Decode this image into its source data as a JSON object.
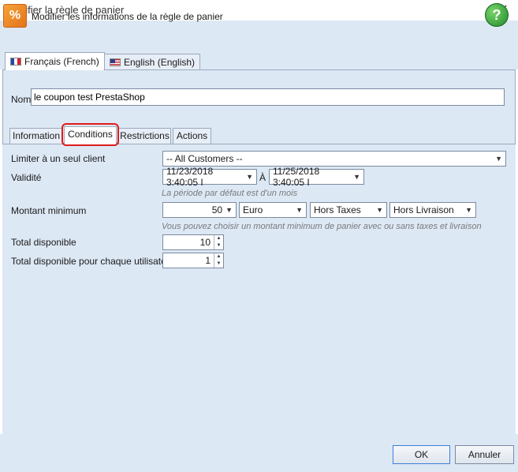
{
  "window": {
    "title": "Modifier la règle de panier",
    "close_glyph": "✕"
  },
  "header": {
    "text": "Modifier les informations de la règle de panier",
    "icon": "percent-tag-icon",
    "icon_glyph": "%",
    "help_glyph": "?"
  },
  "languages": [
    {
      "label": "Français (French)",
      "flag": "flag-fr-icon",
      "active": true
    },
    {
      "label": "English (English)",
      "flag": "flag-us-icon",
      "active": false
    }
  ],
  "name": {
    "label": "Nom",
    "value": "le coupon test PrestaShop"
  },
  "tabs": [
    {
      "label": "Information"
    },
    {
      "label": "Conditions",
      "active": true
    },
    {
      "label": "Restrictions"
    },
    {
      "label": "Actions"
    }
  ],
  "conditions": {
    "customer_label": "Limiter à un seul client",
    "customer_value": "-- All Customers --",
    "validity_label": "Validité",
    "validity_from": "11/23/2018  3:40:05 I",
    "validity_sep": "À",
    "validity_to": "11/25/2018  3:40:05 I",
    "validity_hint": "La période par défaut est d'un mois",
    "min_amount_label": "Montant minimum",
    "min_amount_value": "50",
    "currency": "Euro",
    "tax": "Hors Taxes",
    "shipping": "Hors Livraison",
    "min_amount_hint": "Vous pouvez choisir un montant minimum de panier avec ou sans taxes et livraison",
    "total_label": "Total disponible",
    "total_value": "10",
    "per_user_label": "Total disponible pour chaque utilisateur",
    "per_user_value": "1"
  },
  "footer": {
    "ok_label": "OK",
    "cancel_label": "Annuler"
  },
  "colors": {
    "panel": "#dde8f5",
    "highlight": "#e01b1b"
  }
}
